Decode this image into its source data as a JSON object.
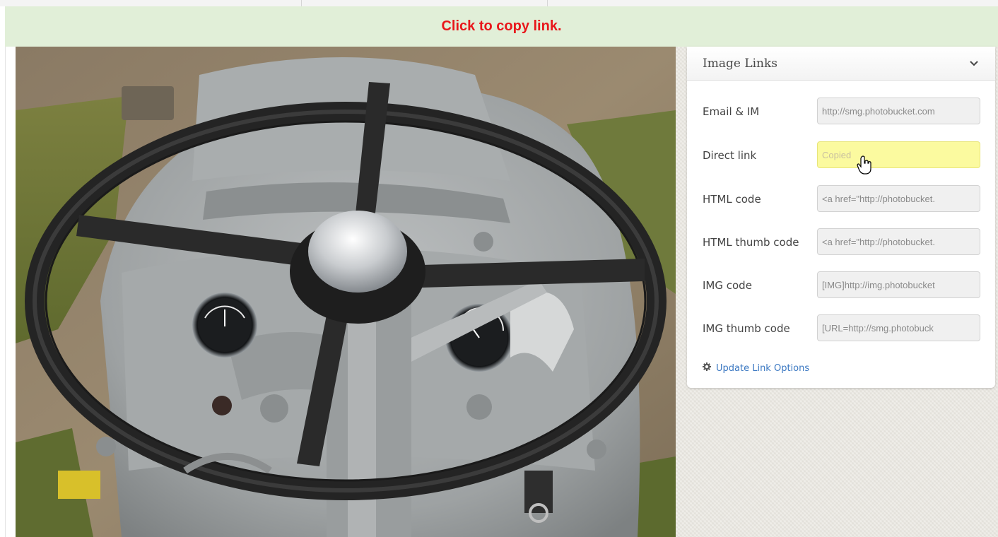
{
  "banner": {
    "text": "Click to copy link."
  },
  "panel": {
    "title": "Image Links",
    "rows": [
      {
        "label": "Email & IM",
        "value": "http://smg.photobucket.com"
      },
      {
        "label": "Direct link",
        "value": "Copied"
      },
      {
        "label": "HTML code",
        "value": "<a href=\"http://photobucket."
      },
      {
        "label": "HTML thumb code",
        "value": "<a href=\"http://photobucket."
      },
      {
        "label": "IMG code",
        "value": "[IMG]http://img.photobucket"
      },
      {
        "label": "IMG thumb code",
        "value": "[URL=http://smg.photobuck"
      }
    ],
    "update_link": "Update Link Options"
  },
  "colors": {
    "banner_bg": "#e1efd8",
    "banner_text": "#e8171b",
    "copied_bg": "#fbfa9f",
    "link": "#3b78c2"
  },
  "icons": [
    "chevron-down-icon",
    "gear-icon",
    "hand-pointer-icon"
  ]
}
